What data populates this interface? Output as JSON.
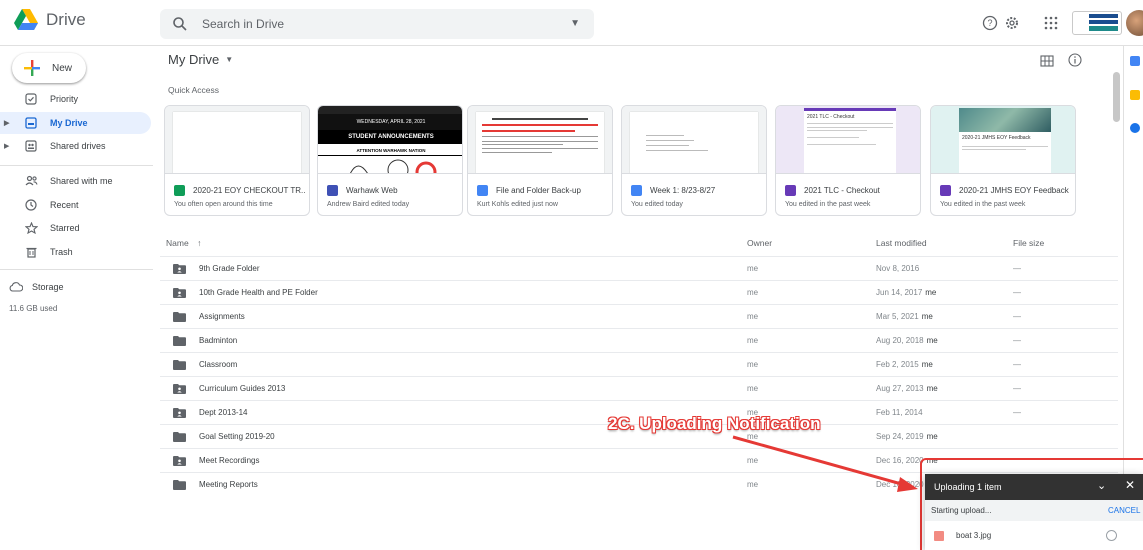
{
  "app": {
    "name": "Drive"
  },
  "search": {
    "placeholder": "Search in Drive"
  },
  "sidebar": {
    "new_label": "New",
    "items": [
      {
        "label": "Priority"
      },
      {
        "label": "My Drive"
      },
      {
        "label": "Shared drives"
      },
      {
        "label": "Shared with me"
      },
      {
        "label": "Recent"
      },
      {
        "label": "Starred"
      },
      {
        "label": "Trash"
      },
      {
        "label": "Storage"
      }
    ],
    "storage_used": "11.6 GB used"
  },
  "main": {
    "title": "My Drive",
    "quick_access_label": "Quick Access",
    "cards": [
      {
        "title": "2020-21 EOY CHECKOUT TR...",
        "subtitle": "You often open around this time",
        "icon": "sheets-icon",
        "color": "#0f9d58"
      },
      {
        "title": "Warhawk Web",
        "subtitle": "Andrew Baird edited today",
        "icon": "sites-icon",
        "color": "#3f51b5"
      },
      {
        "title": "File and Folder Back-up",
        "subtitle": "Kurt Kohls edited just now",
        "icon": "docs-icon",
        "color": "#4285f4"
      },
      {
        "title": "Week 1: 8/23-8/27",
        "subtitle": "You edited today",
        "icon": "docs-icon",
        "color": "#4285f4"
      },
      {
        "title": "2021 TLC - Checkout",
        "subtitle": "You edited in the past week",
        "icon": "forms-icon",
        "color": "#673ab7"
      },
      {
        "title": "2020-21 JMHS EOY Feedback",
        "subtitle": "You edited in the past week",
        "icon": "forms-icon",
        "color": "#673ab7"
      }
    ],
    "thumb_text": {
      "announcements_date": "WEDNESDAY, APRIL 28, 2021",
      "announcements_title": "STUDENT ANNOUNCEMENTS",
      "announcements_sub": "ATTENTION WARHAWK NATION",
      "tlc_title": "2021 TLC - Checkout",
      "feedback_title": "2020-21 JMHS EOY Feedback"
    },
    "columns": {
      "name": "Name",
      "owner": "Owner",
      "modified": "Last modified",
      "size": "File size"
    },
    "rows": [
      {
        "name": "9th Grade Folder",
        "owner": "me",
        "modified": "Nov 8, 2016",
        "by": "",
        "size": "—",
        "shared": true
      },
      {
        "name": "10th Grade Health and PE Folder",
        "owner": "me",
        "modified": "Jun 14, 2017",
        "by": "me",
        "size": "—",
        "shared": true
      },
      {
        "name": "Assignments",
        "owner": "me",
        "modified": "Mar 5, 2021",
        "by": "me",
        "size": "—",
        "shared": false
      },
      {
        "name": "Badminton",
        "owner": "me",
        "modified": "Aug 20, 2018",
        "by": "me",
        "size": "—",
        "shared": false
      },
      {
        "name": "Classroom",
        "owner": "me",
        "modified": "Feb 2, 2015",
        "by": "me",
        "size": "—",
        "shared": false
      },
      {
        "name": "Curriculum Guides 2013",
        "owner": "me",
        "modified": "Aug 27, 2013",
        "by": "me",
        "size": "—",
        "shared": true
      },
      {
        "name": "Dept 2013-14",
        "owner": "me",
        "modified": "Feb 11, 2014",
        "by": "",
        "size": "—",
        "shared": true
      },
      {
        "name": "Goal Setting 2019-20",
        "owner": "me",
        "modified": "Sep 24, 2019",
        "by": "me",
        "size": "",
        "shared": false
      },
      {
        "name": "Meet Recordings",
        "owner": "me",
        "modified": "Dec 16, 2020",
        "by": "me",
        "size": "",
        "shared": true
      },
      {
        "name": "Meeting Reports",
        "owner": "me",
        "modified": "Dec 10, 2020",
        "by": "me",
        "size": "",
        "shared": false
      }
    ]
  },
  "annotation": {
    "label": "2C. Uploading Notification"
  },
  "upload": {
    "title": "Uploading 1 item",
    "status": "Starting upload...",
    "cancel": "CANCEL",
    "file_name": "boat 3.jpg"
  },
  "colors": {
    "accent": "#1a73e8",
    "annotation": "#e53935",
    "active_bg": "#e8f0fe"
  }
}
